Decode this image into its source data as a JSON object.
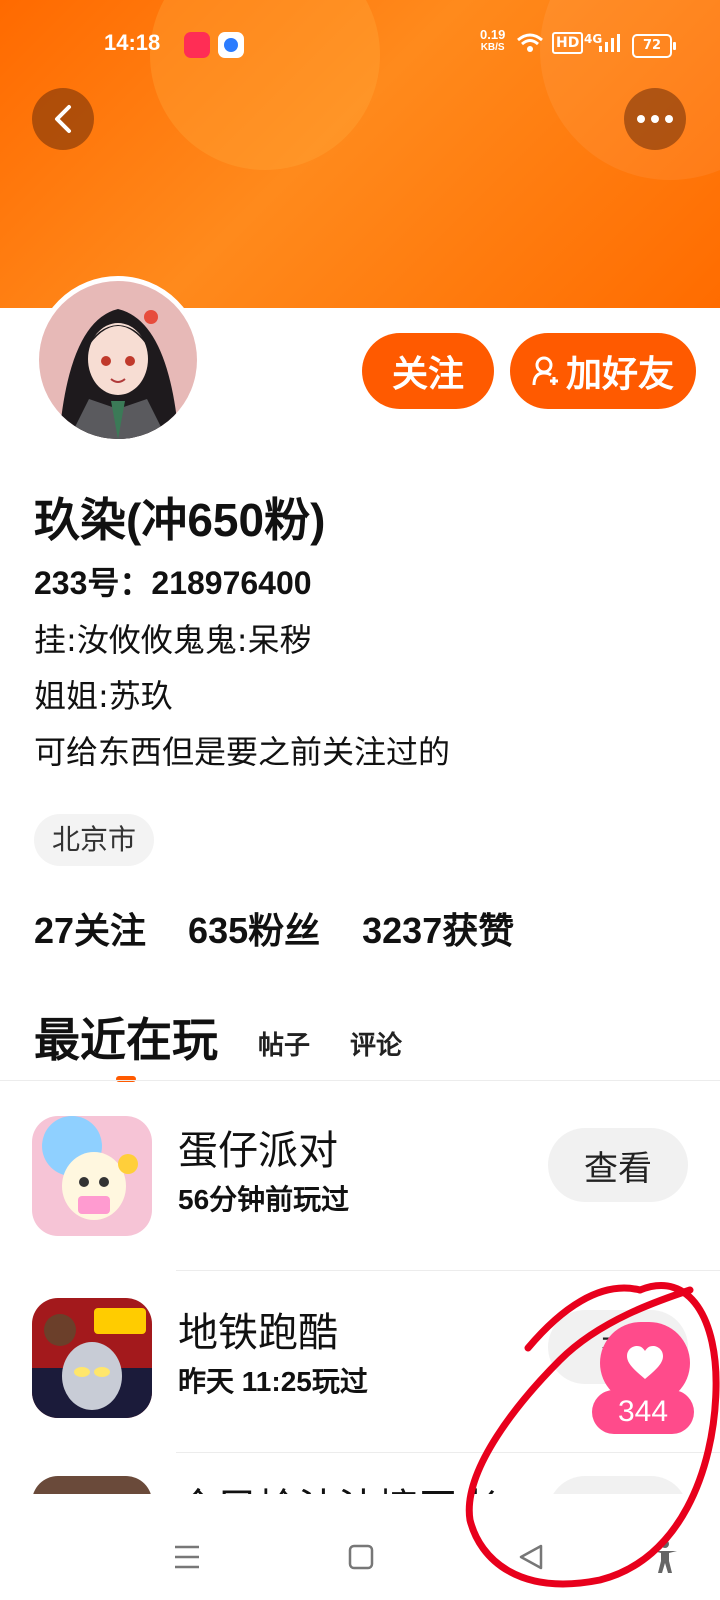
{
  "status_bar": {
    "time": "14:18",
    "net_speed_value": "0.19",
    "net_speed_unit": "KB/S",
    "hd": "HD",
    "signal": "4G",
    "battery": "72"
  },
  "profile": {
    "name": "玖染(冲650粉)",
    "uid": "233号：218976400",
    "bio_lines": [
      "挂:汝攸攸鬼鬼:呆秽",
      "姐姐:苏玖",
      "可给东西但是要之前关注过的"
    ],
    "location": "北京市",
    "follow_label": "关注",
    "add_friend_label": "加好友"
  },
  "stats": {
    "following": "27关注",
    "fans": "635粉丝",
    "likes": "3237获赞"
  },
  "tabs": {
    "recent": "最近在玩",
    "posts": "帖子",
    "comments": "评论"
  },
  "games": [
    {
      "name": "蛋仔派对",
      "played": "56分钟前玩过",
      "button": "查看"
    },
    {
      "name": "地铁跑酷",
      "played": "昨天 11:25玩过",
      "button": "查"
    },
    {
      "name": "全民捡法法擦王老",
      "played": "",
      "button": ""
    }
  ],
  "like_badge": {
    "count": "344"
  },
  "colors": {
    "brand": "#ff5a00",
    "like": "#ff4b8b",
    "annotation": "#e8001c"
  }
}
